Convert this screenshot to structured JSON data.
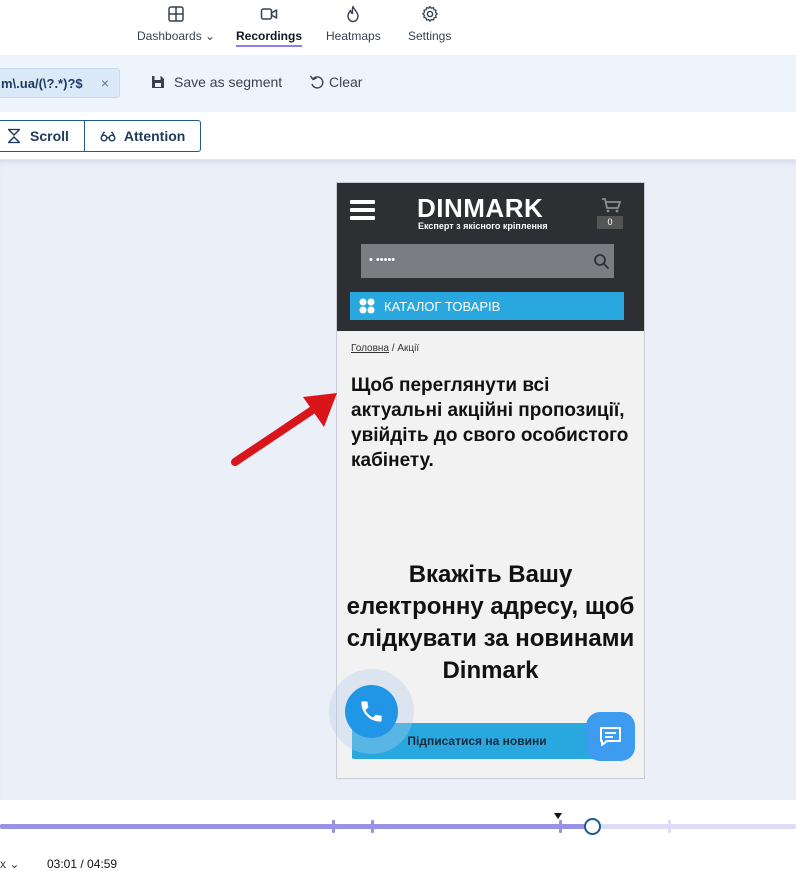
{
  "nav": {
    "items": [
      {
        "label": "Dashboards",
        "icon": "dashboard-icon",
        "dropdown": true
      },
      {
        "label": "Recordings",
        "icon": "video-camera-icon",
        "active": true
      },
      {
        "label": "Heatmaps",
        "icon": "flame-icon"
      },
      {
        "label": "Settings",
        "icon": "gear-icon"
      }
    ]
  },
  "filter": {
    "url_chip": "m\\.ua/(\\?.*)?$",
    "remove": "×",
    "save_segment": "Save as segment",
    "clear": "Clear"
  },
  "modes": {
    "scroll": "Scroll",
    "attention": "Attention"
  },
  "site": {
    "logo": "DINMARK",
    "tagline": "Експерт з якісного кріплення",
    "cart_count": "0",
    "search_value": "• •••••",
    "catalog_label": "КАТАЛОГ ТОВАРІВ",
    "breadcrumb_home": "Головна",
    "breadcrumb_sep": "/",
    "breadcrumb_current": "Акції",
    "notice": "Щоб переглянути всі актуальні акційні пропозиції, увійдіть до свого особистого кабінету.",
    "subscribe_title": "Вкажіть Вашу електронну адресу, щоб слідкувати за новинами Dinmark",
    "subscribe_button": "Підписатися на новини"
  },
  "player": {
    "speed": "x",
    "time": "03:01 / 04:59",
    "progress_fraction": 0.6
  },
  "colors": {
    "accent": "#9b92e6",
    "site_blue": "#29a8e0",
    "arrow": "#d9141a"
  }
}
